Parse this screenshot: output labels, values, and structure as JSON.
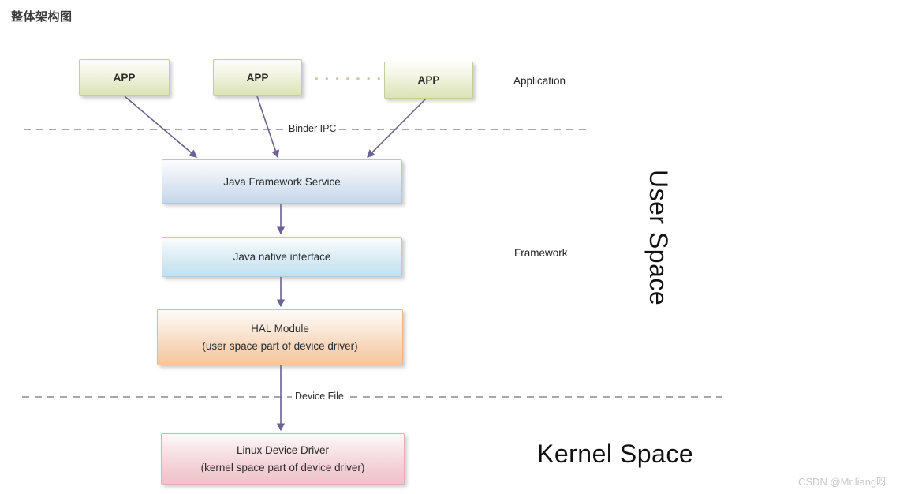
{
  "page": {
    "title": "整体架构图",
    "watermark": "CSDN @Mr.liang呀"
  },
  "diagram": {
    "type": "layered-architecture",
    "app_layer": {
      "boxes": [
        {
          "label": "APP"
        },
        {
          "label": "APP"
        },
        {
          "label": "APP"
        }
      ],
      "ellipsis": "• • • • • • • •",
      "layer_label": "Application"
    },
    "boundaries": [
      {
        "label": "Binder IPC"
      },
      {
        "label": "Device File"
      }
    ],
    "nodes": [
      {
        "line1": "Java Framework Service",
        "line2": ""
      },
      {
        "line1": "Java native interface",
        "line2": ""
      },
      {
        "line1": "HAL Module",
        "line2": "(user space part of device driver)"
      },
      {
        "line1": "Linux Device Driver",
        "line2": "(kernel space part of device driver)"
      }
    ],
    "layer_labels": {
      "framework": "Framework"
    },
    "regions": [
      {
        "label": "User Space"
      },
      {
        "label": "Kernel Space"
      }
    ],
    "colors": {
      "app_fill": "#e3e9c4",
      "framework_service_fill": "#d3e0ef",
      "native_interface_fill": "#cfe7f3",
      "hal_fill": "#f8d3b4",
      "driver_fill": "#f2cdd3",
      "arrow": "#6b6192",
      "dashed_line": "#8a8a8a",
      "title_text": "#3a3a3a"
    }
  }
}
